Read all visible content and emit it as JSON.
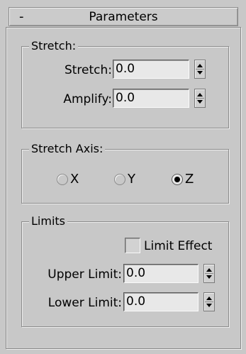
{
  "rollout": {
    "toggle": "-",
    "title": "Parameters"
  },
  "stretch_group": {
    "title": "Stretch:",
    "stretch": {
      "label": "Stretch:",
      "value": "0.0"
    },
    "amplify": {
      "label": "Amplify:",
      "value": "0.0"
    }
  },
  "axis_group": {
    "title": "Stretch Axis:",
    "options": [
      {
        "label": "X",
        "checked": false
      },
      {
        "label": "Y",
        "checked": false
      },
      {
        "label": "Z",
        "checked": true
      }
    ]
  },
  "limits_group": {
    "title": "Limits",
    "limit_effect": {
      "label": "Limit Effect",
      "checked": false
    },
    "upper": {
      "label": "Upper Limit:",
      "value": "0.0"
    },
    "lower": {
      "label": "Lower Limit:",
      "value": "0.0"
    }
  }
}
